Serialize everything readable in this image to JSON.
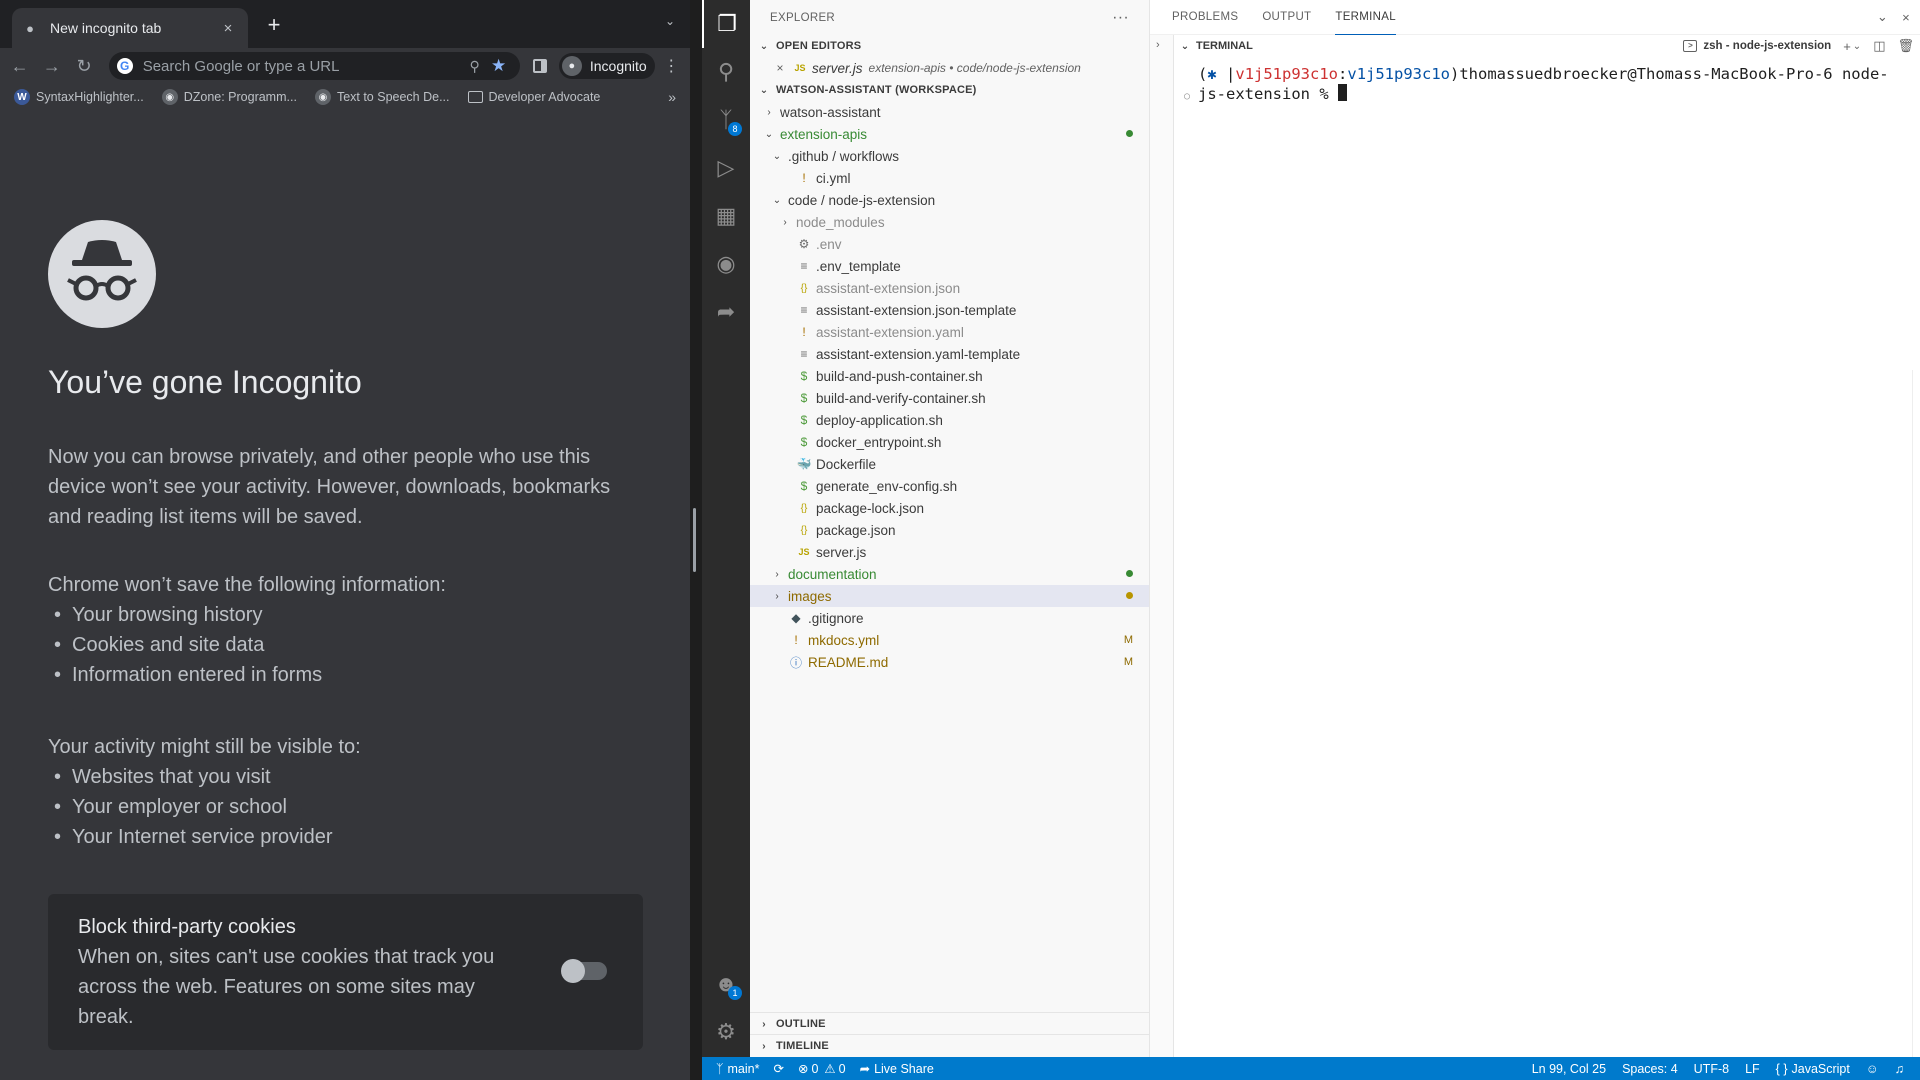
{
  "chrome": {
    "tab_title": "New incognito tab",
    "tab_close": "×",
    "new_tab": "+",
    "omnibox_placeholder": "Search Google or type a URL",
    "profile_label": "Incognito",
    "bookmarks": [
      {
        "label": "SyntaxHighlighter...",
        "icon": "wordpress-icon"
      },
      {
        "label": "DZone: Programm...",
        "icon": "dzone-icon"
      },
      {
        "label": "Text to Speech De...",
        "icon": "globe-icon"
      },
      {
        "label": "Developer Advocate",
        "icon": "folder-icon"
      }
    ],
    "bookmarks_more": "»",
    "page": {
      "heading": "You’ve gone Incognito",
      "lead": "Now you can browse privately, and other people who use this device won’t see your activity. However, downloads, bookmarks and reading list items will be saved.",
      "wont_save_title": "Chrome won’t save the following information:",
      "wont_save_items": [
        "Your browsing history",
        "Cookies and site data",
        "Information entered in forms"
      ],
      "visible_title": "Your activity might still be visible to:",
      "visible_items": [
        "Websites that you visit",
        "Your employer or school",
        "Your Internet service provider"
      ],
      "cookie_title": "Block third-party cookies",
      "cookie_desc": "When on, sites can't use cookies that track you across the web. Features on some sites may break.",
      "cookie_toggle_on": false
    }
  },
  "vscode": {
    "explorer_title": "EXPLORER",
    "explorer_more": "···",
    "open_editors_title": "OPEN EDITORS",
    "open_editor": {
      "name": "server.js",
      "path": "extension-apis • code/node-js-extension",
      "lang": "JS"
    },
    "workspace_title": "WATSON-ASSISTANT (WORKSPACE)",
    "tree": [
      {
        "name": "watson-assistant",
        "chev": "›",
        "indent": 0,
        "type": "folder",
        "color": ""
      },
      {
        "name": "extension-apis",
        "chev": "⌄",
        "indent": 0,
        "type": "folder",
        "color": "green",
        "deco": "dot-green"
      },
      {
        "name": ".github / workflows",
        "chev": "⌄",
        "indent": 1,
        "type": "folder",
        "color": ""
      },
      {
        "name": "ci.yml",
        "icon": "!",
        "indent": 2,
        "type": "file",
        "color": ""
      },
      {
        "name": "code / node-js-extension",
        "chev": "⌄",
        "indent": 1,
        "type": "folder",
        "color": ""
      },
      {
        "name": "node_modules",
        "chev": "›",
        "indent": 2,
        "type": "folder",
        "color": "gray"
      },
      {
        "name": ".env",
        "icon": "⚙",
        "indent": 2,
        "type": "file",
        "color": "gray"
      },
      {
        "name": ".env_template",
        "icon": "≡",
        "indent": 2,
        "type": "file",
        "color": ""
      },
      {
        "name": "assistant-extension.json",
        "icon": "{}",
        "indent": 2,
        "type": "file",
        "color": "gray"
      },
      {
        "name": "assistant-extension.json-template",
        "icon": "≡",
        "indent": 2,
        "type": "file",
        "color": ""
      },
      {
        "name": "assistant-extension.yaml",
        "icon": "!",
        "indent": 2,
        "type": "file",
        "color": "gray"
      },
      {
        "name": "assistant-extension.yaml-template",
        "icon": "≡",
        "indent": 2,
        "type": "file",
        "color": ""
      },
      {
        "name": "build-and-push-container.sh",
        "icon": "$",
        "indent": 2,
        "type": "file",
        "color": ""
      },
      {
        "name": "build-and-verify-container.sh",
        "icon": "$",
        "indent": 2,
        "type": "file",
        "color": ""
      },
      {
        "name": "deploy-application.sh",
        "icon": "$",
        "indent": 2,
        "type": "file",
        "color": ""
      },
      {
        "name": "docker_entrypoint.sh",
        "icon": "$",
        "indent": 2,
        "type": "file",
        "color": ""
      },
      {
        "name": "Dockerfile",
        "icon": "🐳",
        "indent": 2,
        "type": "file",
        "color": ""
      },
      {
        "name": "generate_env-config.sh",
        "icon": "$",
        "indent": 2,
        "type": "file",
        "color": ""
      },
      {
        "name": "package-lock.json",
        "icon": "{}",
        "indent": 2,
        "type": "file",
        "color": ""
      },
      {
        "name": "package.json",
        "icon": "{}",
        "indent": 2,
        "type": "file",
        "color": ""
      },
      {
        "name": "server.js",
        "icon": "JS",
        "indent": 2,
        "type": "file",
        "color": ""
      },
      {
        "name": "documentation",
        "chev": "›",
        "indent": 1,
        "type": "folder",
        "color": "green",
        "deco": "dot-green"
      },
      {
        "name": "images",
        "chev": "›",
        "indent": 1,
        "type": "folder",
        "color": "brown",
        "deco": "dot-brown",
        "selected": true
      },
      {
        "name": ".gitignore",
        "icon": "◆",
        "indent": 1,
        "type": "file",
        "color": ""
      },
      {
        "name": "mkdocs.yml",
        "icon": "!",
        "indent": 1,
        "type": "file",
        "color": "brown",
        "deco": "M"
      },
      {
        "name": "README.md",
        "icon": "ⓘ",
        "indent": 1,
        "type": "file",
        "color": "brown",
        "deco": "M"
      }
    ],
    "outline_title": "OUTLINE",
    "timeline_title": "TIMELINE",
    "panel_tabs": [
      "PROBLEMS",
      "OUTPUT",
      "TERMINAL"
    ],
    "active_panel_tab": "TERMINAL",
    "terminal_section": "TERMINAL",
    "terminal_shell": "zsh - node-js-extension",
    "terminal": {
      "open": "(",
      "star": "✱ ",
      "bar": "|",
      "part1": "v1j51p93c1o",
      "colon": ":",
      "part2": "v1j51p93c1o",
      "close_user": ")thomassuedbroecker@Thomass-MacBook-Pro-6 node-",
      "line2": "js-extension % "
    },
    "status": {
      "branch": "main*",
      "sync": "⟳",
      "errors": "0",
      "warnings": "0",
      "live_share": "Live Share",
      "position": "Ln 99, Col 25",
      "spaces": "Spaces: 4",
      "encoding": "UTF-8",
      "eol": "LF",
      "language": "JavaScript"
    }
  },
  "colors": {
    "chrome_bg": "#35363a",
    "vscode_status": "#007acc",
    "git_added": "#388a34",
    "git_modified": "#8e6a00"
  }
}
